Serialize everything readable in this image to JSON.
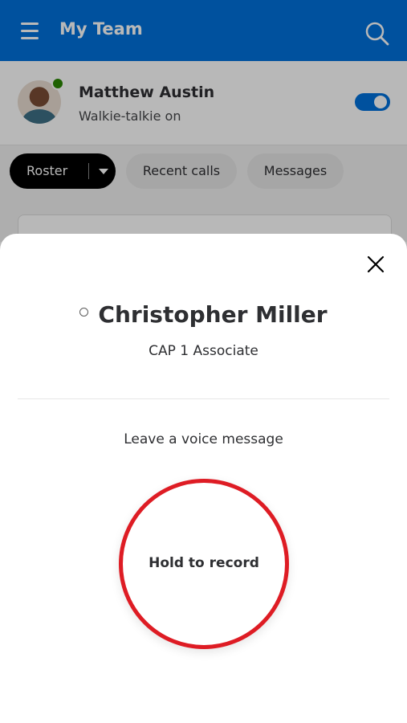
{
  "header": {
    "title": "My Team",
    "menu_icon": "hamburger-menu-icon",
    "search_icon": "search-icon",
    "background_color": "#0071dc"
  },
  "user": {
    "name": "Matthew Austin",
    "status": "Walkie-talkie on",
    "online": true,
    "walkie_talkie_enabled": true
  },
  "tabs": {
    "roster_label": "Roster",
    "recent_calls_label": "Recent calls",
    "messages_label": "Messages",
    "selected": "Roster"
  },
  "sheet": {
    "contact_name": "Christopher Miller",
    "contact_role": "CAP 1 Associate",
    "contact_presence": "offline",
    "voice_prompt": "Leave a voice message",
    "record_label": "Hold to record",
    "record_color": "#de1c24"
  }
}
